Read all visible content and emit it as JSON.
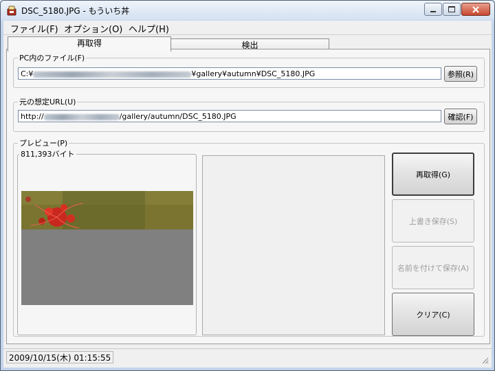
{
  "window": {
    "title": "DSC_5180.JPG - もういち丼"
  },
  "menu": {
    "items": [
      {
        "label": "ファイル(F)"
      },
      {
        "label": "オプション(O)"
      },
      {
        "label": "ヘルプ(H)"
      }
    ]
  },
  "tabs": [
    {
      "label": "再取得",
      "active": true
    },
    {
      "label": "検出",
      "active": false
    }
  ],
  "pc_file": {
    "legend": "PC内のファイル(F)",
    "value_prefix": "C:¥",
    "value_suffix": "¥gallery¥autumn¥DSC_5180.JPG",
    "browse_label": "参照(R)"
  },
  "orig_url": {
    "legend": "元の想定URL(U)",
    "value_prefix": "http://",
    "value_suffix": "/gallery/autumn/DSC_5180.JPG",
    "confirm_label": "確認(F)"
  },
  "preview": {
    "legend": "プレビュー(P)",
    "size_legend": "811,393バイト"
  },
  "buttons": {
    "refetch": "再取得(G)",
    "overwrite": "上書き保存(S)",
    "save_as": "名前を付けて保存(A)",
    "clear": "クリア(C)"
  },
  "status": {
    "datetime": "2009/10/15(木) 01:15:55"
  },
  "colors": {
    "accent": "#3c3c3c",
    "disabled_text": "#9d9d9d",
    "preview_gray": "#808080",
    "photo_olive": "#7a7430",
    "flower_red": "#c8281e"
  }
}
